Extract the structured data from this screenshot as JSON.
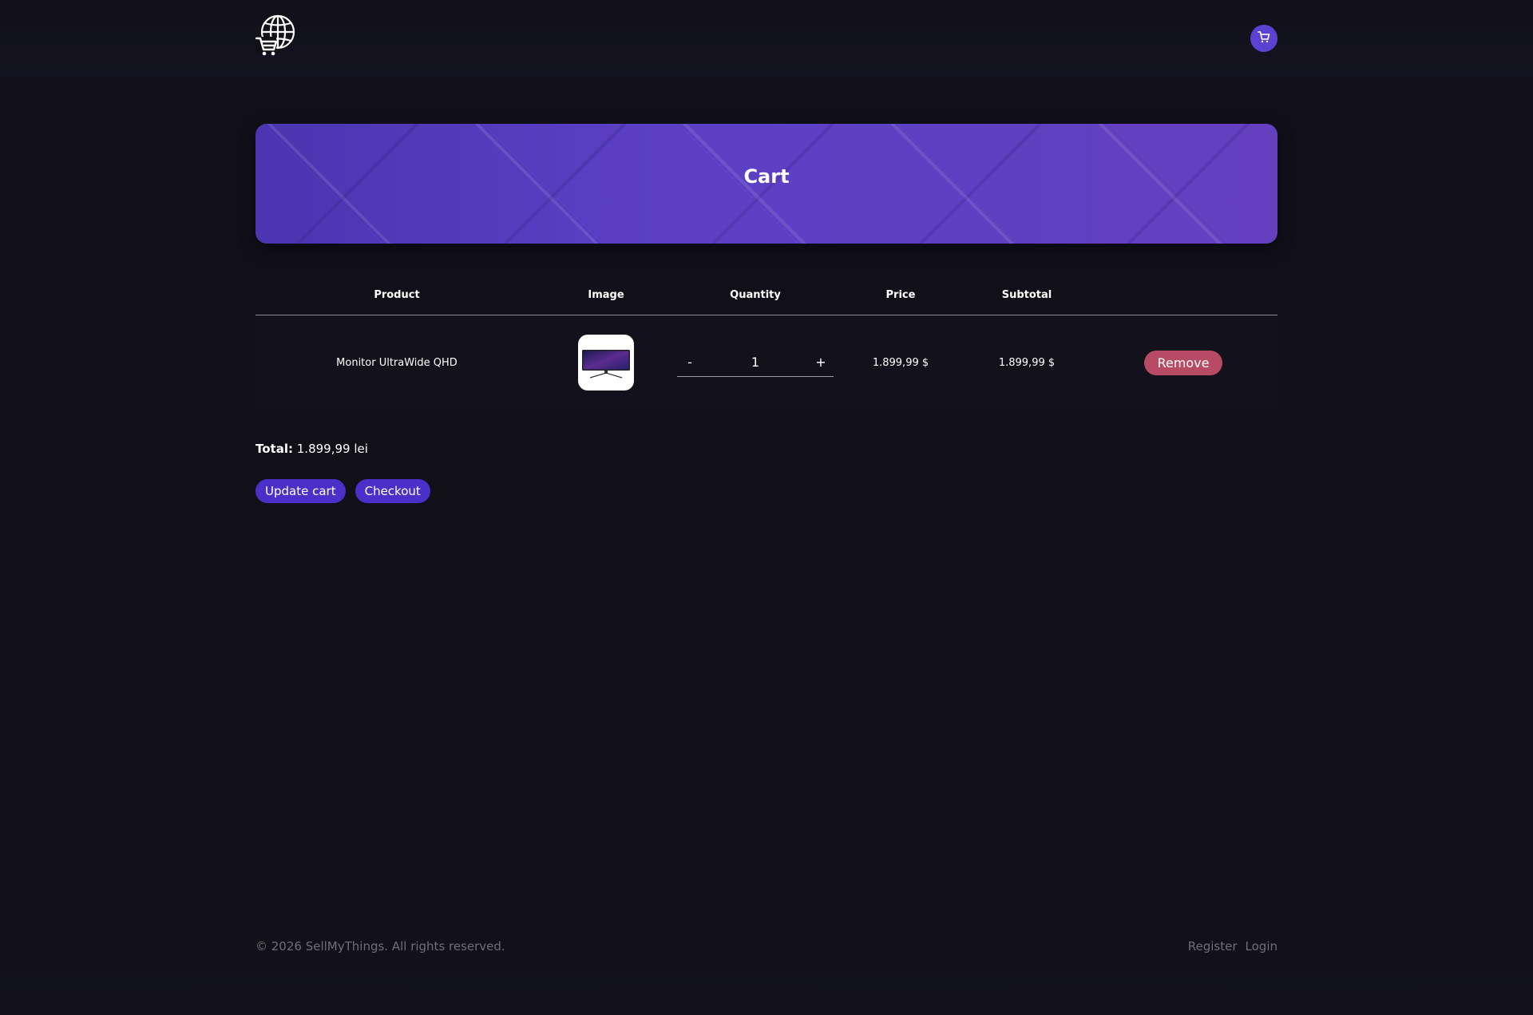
{
  "header": {
    "logo_icon": "globe-cart-logo-icon",
    "cart_icon": "cart-icon",
    "cart_button_color": "#5c42d1"
  },
  "hero": {
    "title": "Cart"
  },
  "table": {
    "headers": {
      "product": "Product",
      "image": "Image",
      "quantity": "Quantity",
      "price": "Price",
      "subtotal": "Subtotal"
    },
    "rows": [
      {
        "product": "Monitor UltraWide QHD",
        "image_icon": "monitor-image",
        "quantity": "1",
        "minus_label": "-",
        "plus_label": "+",
        "price": "1.899,99 $",
        "subtotal": "1.899,99 $",
        "remove_label": "Remove"
      }
    ]
  },
  "summary": {
    "total_label": "Total:",
    "total_value": " 1.899,99 lei"
  },
  "actions": {
    "update_label": "Update cart",
    "checkout_label": "Checkout"
  },
  "footer": {
    "copyright": "© 2026 SellMyThings. All rights reserved.",
    "register_label": "Register",
    "login_label": "Login"
  },
  "colors": {
    "background": "#111019",
    "accent": "#4a30c9",
    "remove": "#b74b63"
  }
}
